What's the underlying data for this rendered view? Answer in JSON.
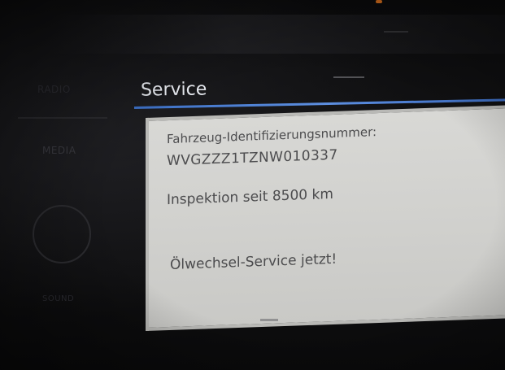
{
  "side_menu": {
    "items": [
      {
        "label": "RADIO",
        "icon": null
      },
      {
        "label": "MEDIA",
        "icon": null
      },
      {
        "label": "SOUND",
        "icon": null
      }
    ],
    "knob_icon": "rotary-knob-icon"
  },
  "header": {
    "title": "Service",
    "accent_color": "#4a7fd6"
  },
  "service_info": {
    "vin_label": "Fahrzeug-Identifizierungsnummer:",
    "vin_value": "WVGZZZ1TZNW010337",
    "inspection_text": "Inspektion seit 8500 km",
    "oil_service_text": "Ölwechsel-Service jetzt!"
  },
  "colors": {
    "panel_background": "#d4d4d1",
    "panel_text": "#4c4c4e",
    "title_text": "#e9ecf2",
    "background": "#0c0c0d"
  }
}
